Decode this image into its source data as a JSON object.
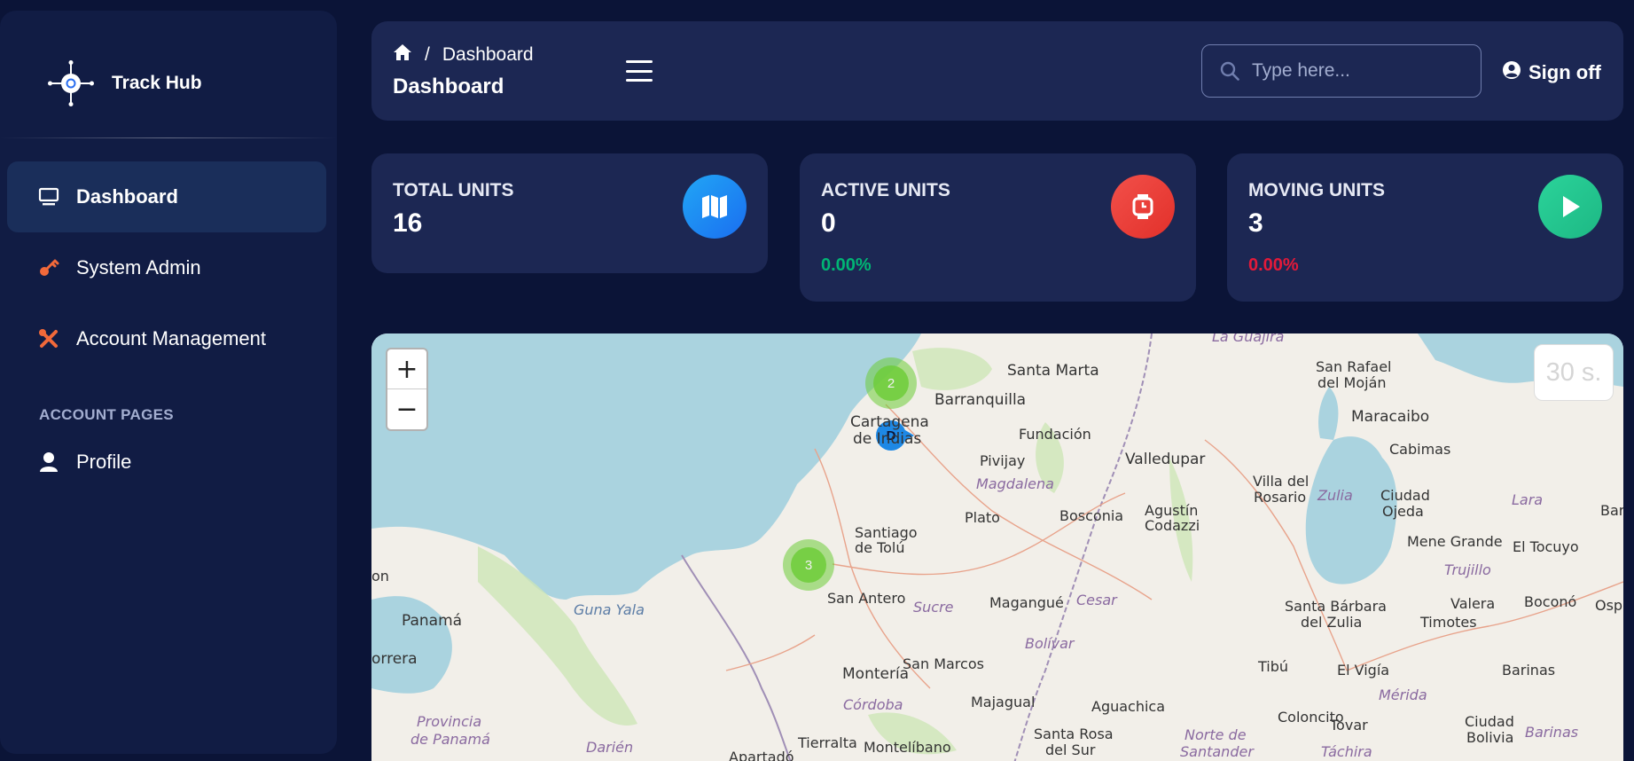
{
  "brand": {
    "name": "Track Hub",
    "logo_icon": "crosshair-logo-icon"
  },
  "sidebar": {
    "items": [
      {
        "label": "Dashboard",
        "icon": "monitor-icon",
        "active": true
      },
      {
        "label": "System Admin",
        "icon": "key-icon",
        "active": false
      },
      {
        "label": "Account Management",
        "icon": "tools-icon",
        "active": false
      }
    ],
    "section_title": "ACCOUNT PAGES",
    "account_items": [
      {
        "label": "Profile",
        "icon": "user-icon"
      }
    ]
  },
  "header": {
    "breadcrumb_separator": "/",
    "breadcrumb_current": "Dashboard",
    "title": "Dashboard",
    "search_placeholder": "Type here...",
    "signoff_label": "Sign off"
  },
  "cards": [
    {
      "title": "TOTAL UNITS",
      "value": "16",
      "pct": "",
      "icon": "map-icon",
      "icon_color": "#1a8ef1"
    },
    {
      "title": "ACTIVE UNITS",
      "value": "0",
      "pct": "0.00%",
      "pct_color": "#01b574",
      "icon": "watch-icon",
      "icon_color": "#f24c3d"
    },
    {
      "title": "MOVING UNITS",
      "value": "3",
      "pct": "0.00%",
      "pct_color": "#e31a3a",
      "icon": "play-icon",
      "icon_color": "#24c98f"
    }
  ],
  "map": {
    "zoom_in": "+",
    "zoom_out": "−",
    "refresh_label": "30 s.",
    "clusters": [
      {
        "count": "2"
      },
      {
        "count": "3"
      }
    ],
    "marker_label": "D",
    "places": {
      "santa_marta": "Santa Marta",
      "barranquilla": "Barranquilla",
      "cartagena_1": "Cartagena",
      "cartagena_2": "de Indias",
      "fundacion": "Fundación",
      "pivijay": "Pivijay",
      "magdalena": "Magdalena",
      "valledupar": "Valledupar",
      "plato": "Plato",
      "bosconia": "Bosconia",
      "agustin_1": "Agustín",
      "agustin_2": "Codazzi",
      "santiago_1": "Santiago",
      "santiago_2": "de Tolú",
      "san_antero": "San Antero",
      "sucre": "Sucre",
      "magangue": "Magangué",
      "cesar": "Cesar",
      "panama": "Panamá",
      "gunayala": "Guna Yala",
      "correra": "orrera",
      "monteria": "Montería",
      "san_marcos": "San Marcos",
      "bolivar": "Bolívar",
      "cordoba": "Córdoba",
      "majagual": "Majagual",
      "aguachica": "Aguachica",
      "prov_1": "Provincia",
      "prov_2": "de Panamá",
      "darien": "Darién",
      "tierralta": "Tierralta",
      "montelibano": "Montelíbano",
      "santa_rosa_1": "Santa Rosa",
      "santa_rosa_2": "del Sur",
      "norte_1": "Norte de",
      "norte_2": "Santander",
      "tibu": "Tibú",
      "san_rafael_1": "San Rafael",
      "san_rafael_2": "del Moján",
      "maracaibo": "Maracaibo",
      "cabimas": "Cabimas",
      "villa_1": "Villa del",
      "villa_2": "Rosario",
      "zulia": "Zulia",
      "ciudad_ojeda_1": "Ciudad",
      "ciudad_ojeda_2": "Ojeda",
      "lara": "Lara",
      "mene": "Mene Grande",
      "tocuyo": "El Tocuyo",
      "trujillo": "Trujillo",
      "valera": "Valera",
      "bocono": "Boconó",
      "santa_barbara_1": "Santa Bárbara",
      "santa_barbara_2": "del Zulia",
      "timotes": "Timotes",
      "el_vigia": "El Vigía",
      "barinas": "Barinas",
      "merida": "Mérida",
      "colon": "Coloncito",
      "tovar": "Tovar",
      "ciudad_bolivia_1": "Ciudad",
      "ciudad_bolivia_2": "Bolivia",
      "barinas_region": "Barinas",
      "tachira": "Táchira",
      "la_guajira": "La Guajira",
      "apartado": "Apartadó",
      "el_n": "on",
      "bar": "Bar",
      "osp": "Osp"
    }
  }
}
